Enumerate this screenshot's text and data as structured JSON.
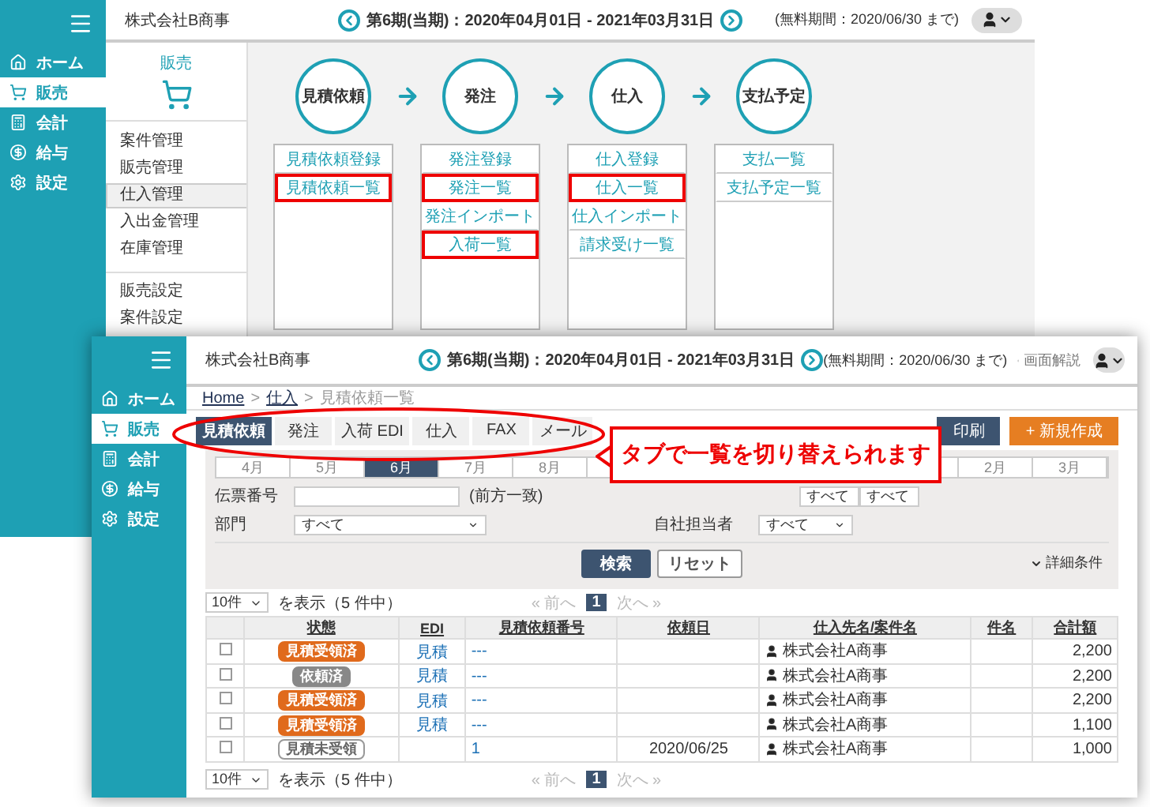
{
  "back_window": {
    "company": "株式会社B商事",
    "period": "第6期(当期)：2020年04月01日 - 2021年03月31日",
    "trial": "(無料期間：2020/06/30 まで)",
    "nav": [
      {
        "label": "ホーム",
        "selected": false
      },
      {
        "label": "販売",
        "selected": true
      },
      {
        "label": "会計",
        "selected": false
      },
      {
        "label": "給与",
        "selected": false
      },
      {
        "label": "設定",
        "selected": false
      }
    ],
    "section": {
      "title": "販売",
      "groups": [
        [
          {
            "label": "案件管理",
            "selected": false
          },
          {
            "label": "販売管理",
            "selected": false
          },
          {
            "label": "仕入管理",
            "selected": true
          },
          {
            "label": "入出金管理",
            "selected": false
          },
          {
            "label": "在庫管理",
            "selected": false
          }
        ],
        [
          {
            "label": "販売設定"
          },
          {
            "label": "案件設定"
          }
        ]
      ]
    },
    "steps": [
      {
        "title": "見積依頼",
        "links": [
          {
            "label": "見積依頼登録",
            "highlighted": false
          },
          {
            "label": "見積依頼一覧",
            "highlighted": true
          }
        ]
      },
      {
        "title": "発注",
        "links": [
          {
            "label": "発注登録",
            "highlighted": false
          },
          {
            "label": "発注一覧",
            "highlighted": true
          },
          {
            "label": "発注インポート",
            "highlighted": false
          },
          {
            "label": "入荷一覧",
            "highlighted": true
          }
        ]
      },
      {
        "title": "仕入",
        "links": [
          {
            "label": "仕入登録",
            "highlighted": false
          },
          {
            "label": "仕入一覧",
            "highlighted": true
          },
          {
            "label": "仕入インポート",
            "highlighted": false
          },
          {
            "label": "請求受け一覧",
            "highlighted": false
          }
        ]
      },
      {
        "title": "支払予定",
        "links": [
          {
            "label": "支払一覧",
            "highlighted": false
          },
          {
            "label": "支払予定一覧",
            "highlighted": false
          }
        ]
      }
    ]
  },
  "front_window": {
    "company": "株式会社B商事",
    "period": "第6期(当期)：2020年04月01日 - 2021年03月31日",
    "trial": "(無料期間：2020/06/30 まで)",
    "help": "画面解説",
    "nav": [
      {
        "label": "ホーム",
        "selected": false
      },
      {
        "label": "販売",
        "selected": true
      },
      {
        "label": "会計",
        "selected": false
      },
      {
        "label": "給与",
        "selected": false
      },
      {
        "label": "設定",
        "selected": false
      }
    ],
    "breadcrumb": [
      {
        "label": "Home"
      },
      {
        "separator": ">",
        "label": "仕入"
      },
      {
        "separator": ">",
        "label": "見積依頼一覧",
        "current": true
      }
    ],
    "tabs": [
      {
        "label": "見積依頼",
        "selected": true
      },
      {
        "label": "発注",
        "selected": false
      },
      {
        "label": "入荷 EDI",
        "selected": false
      },
      {
        "label": "仕入",
        "selected": false
      },
      {
        "label": "FAX",
        "selected": false
      },
      {
        "label": "メール",
        "selected": false
      }
    ],
    "buttons": [
      {
        "label": "印刷",
        "kind": "print"
      },
      {
        "label": "+ 新規作成",
        "kind": "create"
      }
    ],
    "months_before": [
      {
        "label": "4月",
        "selected": false
      },
      {
        "label": "5月",
        "selected": false
      },
      {
        "label": "6月",
        "selected": true
      },
      {
        "label": "7月",
        "selected": false
      },
      {
        "label": "8月",
        "selected": false
      }
    ],
    "months_after": [
      {
        "label": "2月",
        "selected": false
      },
      {
        "label": "3月",
        "selected": false
      }
    ],
    "filters": {
      "slip_label": "伝票番号",
      "slip_note": "(前方一致)",
      "status_options": [
        "すべて",
        "すべて"
      ],
      "dept_label": "部門",
      "dept_value": "すべて",
      "staff_label": "自社担当者",
      "staff_value": "すべて"
    },
    "search_button": "検索",
    "reset_button": "リセット",
    "advanced": "詳細条件",
    "paging": {
      "per_page": "10件",
      "showing": "を表示（5 件中）",
      "prev": "« 前へ",
      "page": "1",
      "next": "次へ »"
    },
    "table": {
      "columns": [
        "状態",
        "EDI",
        "見積依頼番号",
        "依頼日",
        "仕入先名/案件名",
        "件名",
        "合計額"
      ],
      "rows": [
        {
          "checked": false,
          "status": {
            "label": "見積受領済",
            "color": "#e06a1c"
          },
          "edi": "見積",
          "number": "---",
          "date": "",
          "supplier": "株式会社A商事",
          "total": "2,200"
        },
        {
          "checked": false,
          "status": {
            "label": "依頼済",
            "color": "#888888"
          },
          "edi": "見積",
          "number": "---",
          "date": "",
          "supplier": "株式会社A商事",
          "total": "2,200"
        },
        {
          "checked": false,
          "status": {
            "label": "見積受領済",
            "color": "#e06a1c"
          },
          "edi": "見積",
          "number": "---",
          "date": "",
          "supplier": "株式会社A商事",
          "total": "2,200"
        },
        {
          "checked": false,
          "status": {
            "label": "見積受領済",
            "color": "#e06a1c"
          },
          "edi": "見積",
          "number": "---",
          "date": "",
          "supplier": "株式会社A商事",
          "total": "1,100"
        },
        {
          "checked": false,
          "status": {
            "label": "見積未受領",
            "color": "#ffffff"
          },
          "edi": "",
          "number": "1",
          "date": "2020/06/25",
          "supplier": "株式会社A商事",
          "total": "1,000"
        }
      ]
    },
    "paging_bottom": {
      "per_page": "10件",
      "showing": "を表示（5 件中）",
      "prev": "« 前へ",
      "page": "1",
      "next": "次へ »"
    }
  },
  "callout": "タブで一覧を切り替えられます"
}
